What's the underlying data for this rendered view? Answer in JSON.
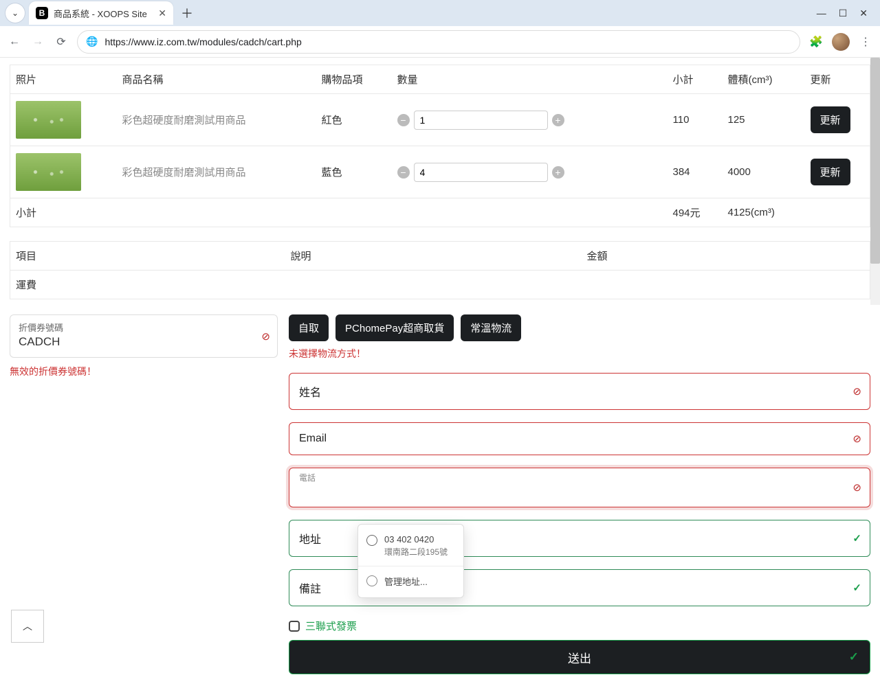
{
  "browser": {
    "tab_favicon_letter": "B",
    "tab_title": "商品系統 - XOOPS Site",
    "url": "https://www.iz.com.tw/modules/cadch/cart.php"
  },
  "cart": {
    "headers": {
      "photo": "照片",
      "name": "商品名稱",
      "variant": "購物品項",
      "qty": "數量",
      "subtotal": "小計",
      "volume": "體積(cm³)",
      "update": "更新"
    },
    "rows": [
      {
        "name": "彩色超硬度耐磨測試用商品",
        "variant": "紅色",
        "qty": "1",
        "subtotal": "110",
        "volume": "125",
        "update": "更新"
      },
      {
        "name": "彩色超硬度耐磨測試用商品",
        "variant": "藍色",
        "qty": "4",
        "subtotal": "384",
        "volume": "4000",
        "update": "更新"
      }
    ],
    "footer": {
      "label": "小計",
      "subtotal": "494元",
      "volume": "4125(cm³)"
    }
  },
  "fee": {
    "headers": {
      "item": "項目",
      "desc": "說明",
      "amount": "金額"
    },
    "row_label": "運費"
  },
  "coupon": {
    "label": "折價券號碼",
    "value": "CADCH",
    "error": "無效的折價券號碼！"
  },
  "shipping": {
    "options": [
      "自取",
      "PChomePay超商取貨",
      "常溫物流"
    ],
    "warn": "未選擇物流方式！"
  },
  "form": {
    "name_label": "姓名",
    "email_label": "Email",
    "phone_label": "電話",
    "address_label": "地址",
    "note_label": "備註",
    "invoice_label": "三聯式發票",
    "submit": "送出"
  },
  "autofill": {
    "phone": "03 402 0420",
    "address": "環南路二段195號",
    "manage": "管理地址..."
  },
  "scroll_top_title": "回到頂端"
}
